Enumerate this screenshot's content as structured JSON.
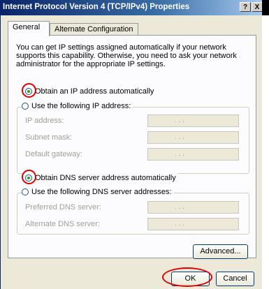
{
  "window": {
    "title": "Internet Protocol Version 4 (TCP/IPv4) Properties",
    "help_button": "?",
    "close_button": "X"
  },
  "tabs": [
    {
      "label": "General",
      "active": true
    },
    {
      "label": "Alternate Configuration",
      "active": false
    }
  ],
  "description": "You can get IP settings assigned automatically if your network supports this capability. Otherwise, you need to ask your network administrator for the appropriate IP settings.",
  "ip_settings": {
    "auto_label": "Obtain an IP address automatically",
    "auto_selected": true,
    "manual_label": "Use the following IP address:",
    "fields": [
      {
        "label": "IP address:",
        "value": ". . ."
      },
      {
        "label": "Subnet mask:",
        "value": ". . ."
      },
      {
        "label": "Default gateway:",
        "value": ". . ."
      }
    ]
  },
  "dns_settings": {
    "auto_label": "Obtain DNS server address automatically",
    "auto_selected": true,
    "manual_label": "Use the following DNS server addresses:",
    "fields": [
      {
        "label": "Preferred DNS server:",
        "value": ". . ."
      },
      {
        "label": "Alternate DNS server:",
        "value": ". . ."
      }
    ]
  },
  "buttons": {
    "advanced": "Advanced...",
    "ok": "OK",
    "cancel": "Cancel"
  },
  "colors": {
    "highlight_ring": "#e00000",
    "title_bar": "#0a246a",
    "dialog_bg": "#ece9d8"
  }
}
